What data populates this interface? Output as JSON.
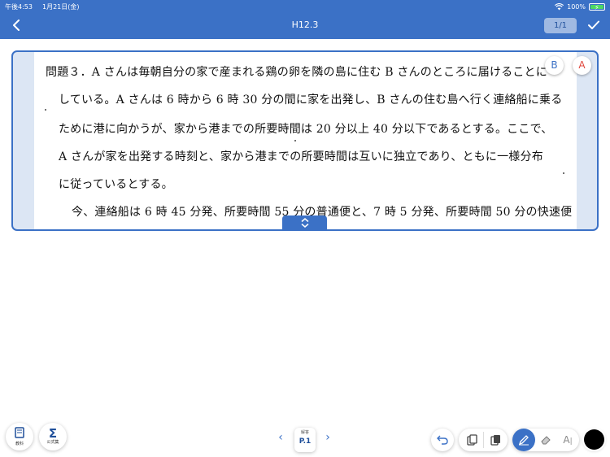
{
  "status_bar": {
    "time": "午後4:53",
    "date": "1月21日(金)",
    "battery": "100%"
  },
  "nav": {
    "title": "H12.3",
    "page_indicator": "1/1"
  },
  "problem": {
    "lines": [
      "問題３．A さんは毎朝自分の家で産まれる鶏の卵を隣の島に住む B さんのところに届けることに",
      "している。A さんは 6 時から 6 時 30 分の間に家を出発し、B さんの住む島へ行く連絡船に乗る",
      "ために港に向かうが、家から港までの所要時間は 20 分以上 40 分以下であるとする。ここで、",
      "A さんが家を出発する時刻と、家から港までの所要時間は互いに独立であり、ともに一様分布",
      "に従っているとする。",
      "今、連絡船は 6 時 45 分発、所要時間 55 分の普通便と、7 時 5 分発、所要時間 50 分の快速便"
    ]
  },
  "answer_toggles": {
    "b_label": "B",
    "a_label": "A"
  },
  "bottom": {
    "book_caption": "教科",
    "formula_caption": "公式集",
    "answer_small": "解答",
    "answer_page": "P.1"
  },
  "colors": {
    "accent": "#3b71c6",
    "card_bg": "#dce6f4",
    "pen_color": "#000000"
  },
  "icons": [
    "back-chevron-icon",
    "wifi-icon",
    "battery-icon",
    "check-icon",
    "expand-chevron-icon",
    "book-icon",
    "sigma-icon",
    "undo-icon",
    "copy-icon",
    "paste-icon",
    "pen-icon",
    "eraser-icon",
    "text-icon"
  ]
}
